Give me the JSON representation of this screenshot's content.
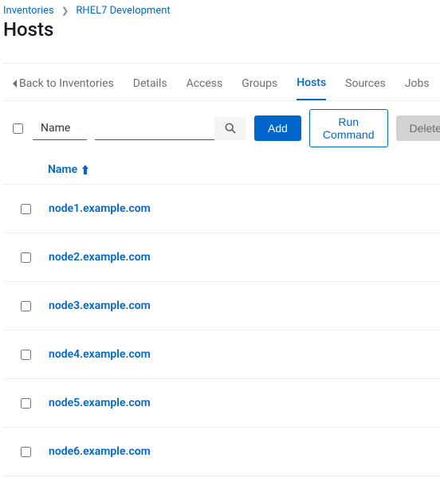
{
  "breadcrumb": {
    "root": "Inventories",
    "current": "RHEL7 Development"
  },
  "page": {
    "title": "Hosts"
  },
  "tabs": {
    "back": "Back to Inventories",
    "details": "Details",
    "access": "Access",
    "groups": "Groups",
    "hosts": "Hosts",
    "sources": "Sources",
    "jobs": "Jobs"
  },
  "toolbar": {
    "filter_field": "Name",
    "search_placeholder": "",
    "add": "Add",
    "run_command": "Run Command",
    "delete": "Delete"
  },
  "table": {
    "col_name": "Name"
  },
  "hosts": [
    {
      "name": "node1.example.com"
    },
    {
      "name": "node2.example.com"
    },
    {
      "name": "node3.example.com"
    },
    {
      "name": "node4.example.com"
    },
    {
      "name": "node5.example.com"
    },
    {
      "name": "node6.example.com"
    }
  ]
}
